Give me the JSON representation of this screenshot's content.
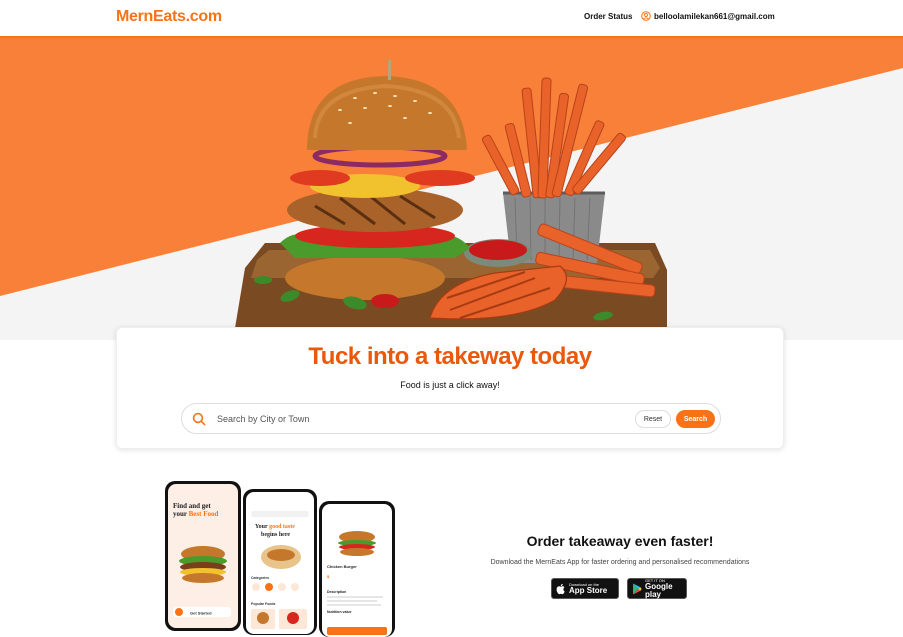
{
  "header": {
    "logo": "MernEats.com",
    "order_status": "Order Status",
    "user_email": "belloolamilekan661@gmail.com"
  },
  "hero": {
    "image": "burger-and-fries-image"
  },
  "search_card": {
    "title": "Tuck into a takeway today",
    "subtitle": "Food is just a click away!",
    "search_placeholder": "Search by City or Town",
    "reset_label": "Reset",
    "search_label": "Search"
  },
  "promo": {
    "title": "Order takeaway even faster!",
    "text": "Download the MernEats App for faster ordering and personalised recommendations",
    "app_store_small": "Download on the",
    "app_store_big": "App Store",
    "google_play_small": "GET IT ON",
    "google_play_big": "Google play",
    "phone1_heading_1": "Find and get",
    "phone1_heading_2": "your",
    "phone1_heading_accent": "Best Food",
    "phone1_button": "Get Started",
    "phone2_heading_1": "Your",
    "phone2_heading_accent": "good taste",
    "phone2_heading_2": "begins here",
    "phone2_categories": "Categories",
    "phone2_popular": "Popular Foods",
    "phone3_item": "Chicken Burger",
    "phone3_description": "Description",
    "phone3_nutrition": "Nutrition value"
  },
  "colors": {
    "brand": "#f97316",
    "brand_dark": "#ea580c",
    "hero_gray": "#f4f4f4"
  }
}
